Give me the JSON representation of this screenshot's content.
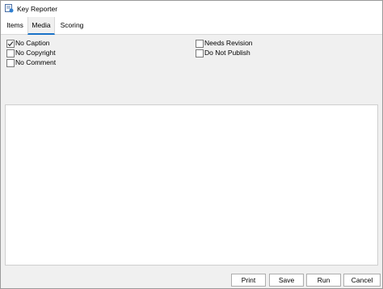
{
  "window": {
    "title": "Key Reporter",
    "icon": "key-reporter-app-icon"
  },
  "tabs": [
    {
      "label": "Items",
      "active": false
    },
    {
      "label": "Media",
      "active": true
    },
    {
      "label": "Scoring",
      "active": false
    }
  ],
  "filters": {
    "left": [
      {
        "label": "No Caption",
        "checked": true
      },
      {
        "label": "No Copyright",
        "checked": false
      },
      {
        "label": "No Comment",
        "checked": false
      }
    ],
    "right": [
      {
        "label": "Needs Revision",
        "checked": false
      },
      {
        "label": "Do Not Publish",
        "checked": false
      }
    ]
  },
  "buttons": {
    "print": "Print",
    "save": "Save",
    "run": "Run",
    "cancel": "Cancel"
  },
  "colors": {
    "accent": "#1a73c8",
    "panel": "#f0f0f0"
  }
}
